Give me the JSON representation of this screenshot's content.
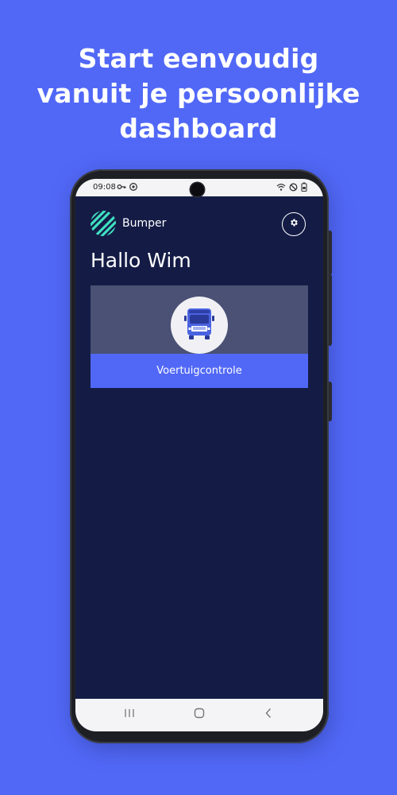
{
  "headline": {
    "line1": "Start eenvoudig",
    "line2": "vanuit je persoonlijke",
    "line3": "dashboard"
  },
  "status_bar": {
    "time": "09:08",
    "left_icons": [
      "key-icon",
      "sync-icon"
    ],
    "right_icons": [
      "wifi-icon",
      "do-not-disturb-icon",
      "battery-lock-icon"
    ]
  },
  "app": {
    "brand": "Bumper",
    "greeting": "Hallo Wim",
    "settings_icon": "gear-icon"
  },
  "card": {
    "icon": "truck-icon",
    "label": "Voertuigcontrole"
  },
  "navbar": {
    "buttons": [
      "recent-apps-icon",
      "home-icon",
      "back-icon"
    ]
  },
  "colors": {
    "background": "#5168f7",
    "app_background": "#141c46",
    "card_top": "#4a5175",
    "card_bottom": "#5168f7",
    "logo": "#3fe0c0",
    "truck": "#4a63e0"
  }
}
